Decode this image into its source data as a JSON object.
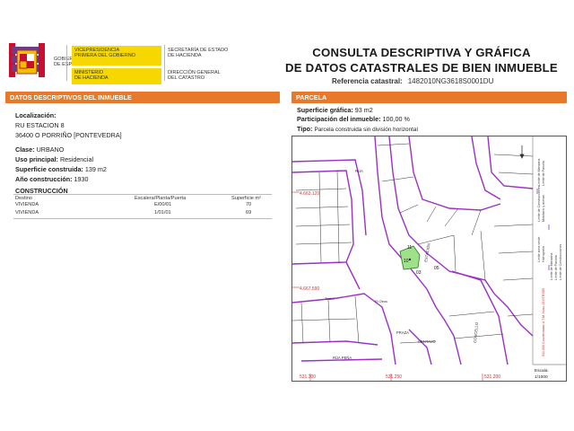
{
  "header": {
    "gov_lines_1": [
      "VICEPRESIDENCIA",
      "PRIMERA DEL GOBIERNO"
    ],
    "gov_lines_2": [
      "GOBIERNO",
      "DE ESPAÑA"
    ],
    "gov_lines_3": [
      "MINISTERIO",
      "DE HACIENDA"
    ],
    "gov_lines_4": [
      "SECRETARÍA DE ESTADO",
      "DE HACIENDA"
    ],
    "gov_lines_5": [
      "DIRECCIÓN GENERAL",
      "DEL CATASTRO"
    ],
    "title_line1": "CONSULTA DESCRIPTIVA Y GRÁFICA",
    "title_line2": "DE DATOS CATASTRALES DE BIEN INMUEBLE",
    "ref_label": "Referencia catastral:",
    "ref_value": "1482010NG3618S0001DU"
  },
  "colors": {
    "accent": "#e7792b",
    "map_line": "#9b30c8",
    "parcel_fill": "#9fe08a"
  },
  "left": {
    "section_title": "DATOS DESCRIPTIVOS DEL INMUEBLE",
    "localizacion_label": "Localización:",
    "address_1": "RU ESTACION 8",
    "address_2": "36400 O PORRIÑO [PONTEVEDRA]",
    "clase_label": "Clase:",
    "clase_value": "URBANO",
    "uso_label": "Uso principal:",
    "uso_value": "Residencial",
    "sup_label": "Superficie construida:",
    "sup_value": "139 m2",
    "anio_label": "Año construcción:",
    "anio_value": "1930",
    "construccion_title": "CONSTRUCCIÓN",
    "table": {
      "headers": [
        "Destino",
        "Escalera/Planta/Puerta",
        "Superficie m²"
      ],
      "rows": [
        [
          "VIVIENDA",
          "E/00/01",
          "70"
        ],
        [
          "VIVIENDA",
          "1/01/01",
          "69"
        ]
      ]
    }
  },
  "right": {
    "section_title": "PARCELA",
    "sup_graf_label": "Superficie gráfica:",
    "sup_graf_value": "93 m2",
    "part_label": "Participación del inmueble:",
    "part_value": "100,00 %",
    "tipo_label": "Tipo:",
    "tipo_value": "Parcela construida sin división horizontal",
    "map": {
      "y_labels": [
        "4.663.120",
        "4.667.590"
      ],
      "x_labels": [
        "531.300",
        "531.250",
        "531.200"
      ],
      "street_labels": [
        "RUA",
        "ESTACIÓN",
        "PRAZA",
        "CENTAVO",
        "RÚA PEÑA",
        "CONCELLO"
      ],
      "parcel_numbers": [
        "10",
        "03",
        "05",
        "11"
      ],
      "block_labels": [
        "Teatro",
        "Ri Otros"
      ],
      "legend_top": [
        "Limite de Manzana",
        "Limite de Parcela",
        "Limite de Construcciones",
        "Mobiliario y aceras",
        "Limite zona verde",
        "Hidrografía"
      ],
      "legend_bottom": [
        "Limite de Manzana",
        "Limite de Parcela",
        "Limite de Construcciones"
      ],
      "coord_note": "531.000 Coordenadas U.T.M. Huso 29 ETRS89",
      "scale_label": "Escala:",
      "scale_value": "1/1000"
    }
  }
}
